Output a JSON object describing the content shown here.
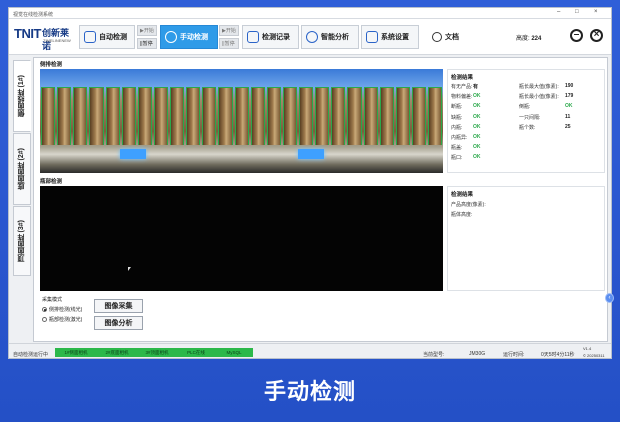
{
  "window": {
    "title": "视觉在线检测系统",
    "minimize_glyph": "–",
    "maximize_glyph": "□",
    "close_glyph": "×"
  },
  "logo": {
    "mark": "TNIT",
    "name_cn": "创新莱诺",
    "name_en": "TIMELINENEW"
  },
  "nav": {
    "auto_detect": "自动检测",
    "manual_detect": "手动检测",
    "records": "检测记录",
    "analysis": "智能分析",
    "settings": "系统设置",
    "docs": "文档",
    "mini_start": "▶开始",
    "mini_pause": "||暂停",
    "mini_start_2": "▶开始",
    "mini_pause_2": "||暂停"
  },
  "station": {
    "label": "高度:",
    "value": "224"
  },
  "side_tabs": {
    "tab1": "侧面线阵 (1#)",
    "tab2": "底面面阵 (2#)",
    "tab3": "顶面面阵 (3#)"
  },
  "panel1": {
    "title": "侧排检测"
  },
  "panel2": {
    "title": "瓶部检测"
  },
  "results1": {
    "title": "检测结果",
    "rows": [
      {
        "k1": "有无产品:",
        "v1": "有",
        "k2": "瓶长最大值(像素):",
        "v2": "190"
      },
      {
        "k1": "物料偏差:",
        "v1": "OK",
        "k2": "瓶长最小值(像素):",
        "v2": "179"
      },
      {
        "k1": "断瓶:",
        "v1": "OK",
        "k2": "倒瓶:",
        "v2": "OK"
      },
      {
        "k1": "缺瓶:",
        "v1": "OK",
        "k2": "一只间隔:",
        "v2": "11"
      },
      {
        "k1": "内瓶:",
        "v1": "OK",
        "k2": "瓶个数:",
        "v2": "25"
      },
      {
        "k1": "内瓶异:",
        "v1": "OK",
        "k2": "",
        "v2": ""
      },
      {
        "k1": "瓶盖:",
        "v1": "OK",
        "k2": "",
        "v2": ""
      },
      {
        "k1": "瓶口:",
        "v1": "OK",
        "k2": "",
        "v2": ""
      }
    ]
  },
  "results2": {
    "title": "检测结果",
    "line1": "产品高度(像素):",
    "line2": "瓶体高度:"
  },
  "mode": {
    "title": "采集模式",
    "option1": "侧排检测(线光)",
    "option2": "瓶部检测(激光)"
  },
  "actions": {
    "capture": "图像采集",
    "analyze": "图像分析"
  },
  "statusbar": {
    "running": "自动检测运行中",
    "pill1": "1#侧面相机",
    "pill2": "2#底面相机",
    "pill3": "3#顶面相机",
    "pill4": "PLC在线",
    "pill5": "MySQL",
    "model_label": "当前型号:",
    "model_value": "JM30G",
    "runtime_label": "运行时间:",
    "runtime_value": "0天5时4分11秒",
    "version": "V1.4",
    "build": "© 20250311"
  },
  "caption": "手动检测",
  "colors": {
    "ok": "#2aa84a",
    "accent": "#2f9be8",
    "background": "#2a56cf"
  }
}
